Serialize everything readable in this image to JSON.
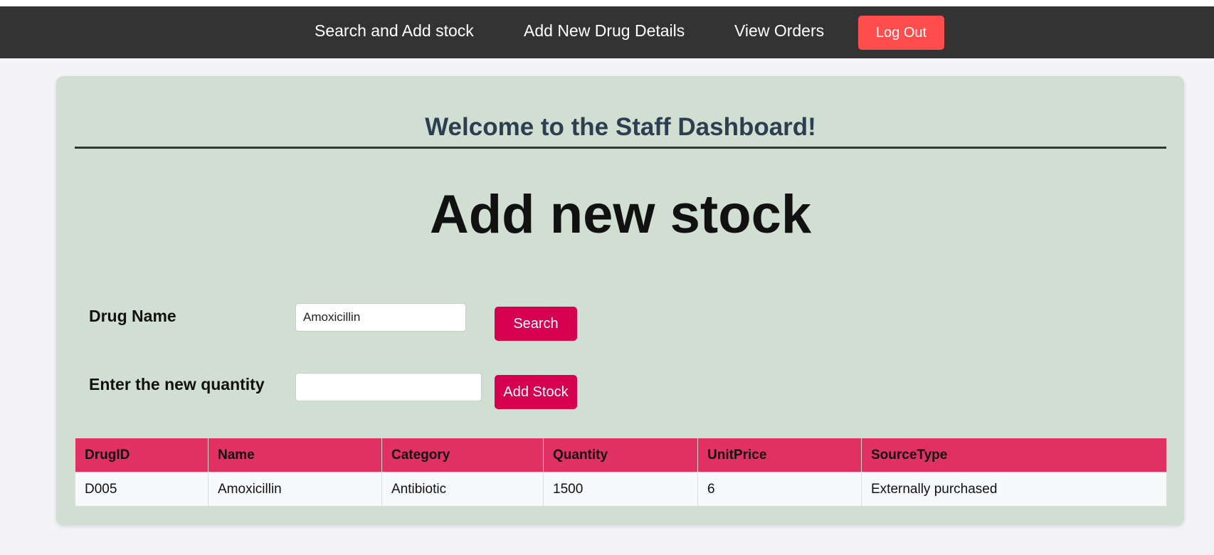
{
  "nav": {
    "links": [
      {
        "label": "Search and Add stock"
      },
      {
        "label": "Add New Drug Details"
      },
      {
        "label": "View Orders"
      }
    ],
    "logout_label": "Log Out"
  },
  "dashboard": {
    "welcome": "Welcome to the Staff Dashboard!",
    "title": "Add new stock"
  },
  "form": {
    "drug_name_label": "Drug Name",
    "drug_name_value": "Amoxicillin",
    "search_label": "Search",
    "quantity_label": "Enter the new quantity",
    "quantity_value": "",
    "add_stock_label": "Add Stock"
  },
  "table": {
    "headers": [
      "DrugID",
      "Name",
      "Category",
      "Quantity",
      "UnitPrice",
      "SourceType"
    ],
    "rows": [
      [
        "D005",
        "Amoxicillin",
        "Antibiotic",
        "1500",
        "6",
        "Externally purchased"
      ]
    ]
  },
  "colors": {
    "navbar": "#333333",
    "logout_button": "#ff4d4d",
    "card_background": "#d1ded2",
    "action_button": "#d6004f",
    "table_header": "#e03162",
    "welcome_text": "#2c3e50"
  }
}
